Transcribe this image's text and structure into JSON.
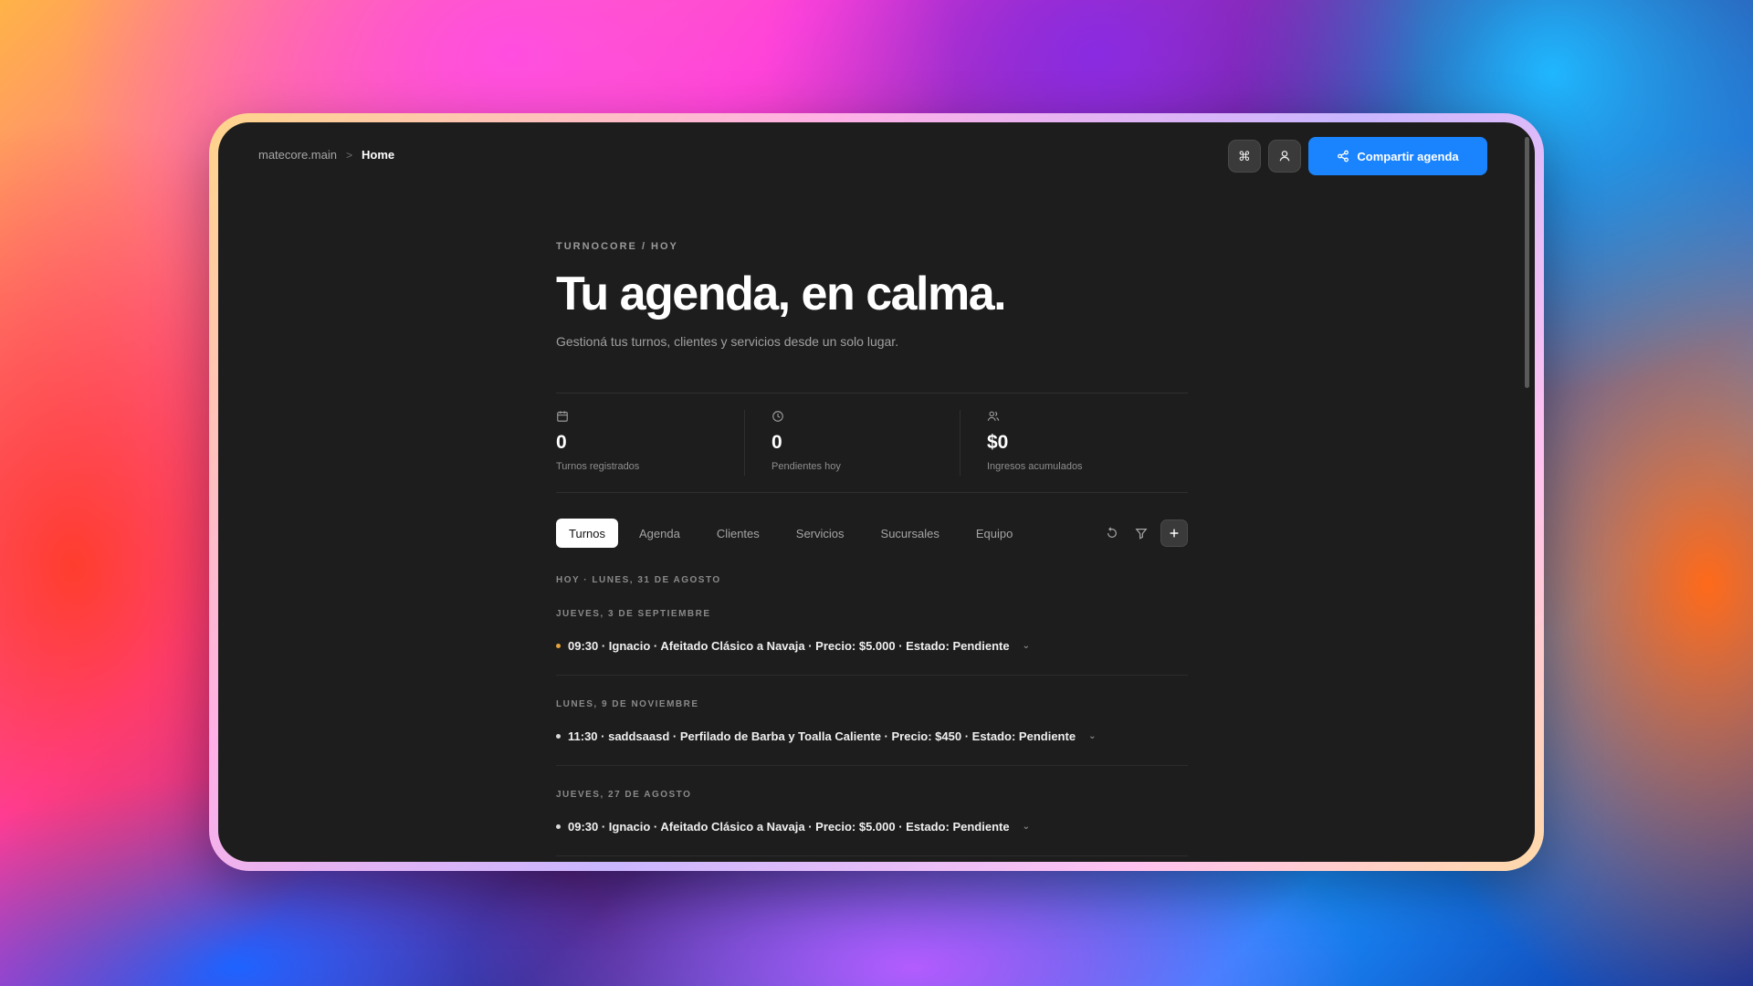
{
  "breadcrumb": {
    "root": "matecore.main",
    "separator": ">",
    "current": "Home"
  },
  "topbar": {
    "command_icon": "command-icon",
    "user_icon": "user-icon",
    "share_icon": "share-icon",
    "share_label": "Compartir agenda"
  },
  "hero": {
    "eyebrow": "TURNOCORE / HOY",
    "title": "Tu agenda, en calma.",
    "subtitle": "Gestioná tus turnos, clientes y servicios desde un solo lugar."
  },
  "stats": [
    {
      "icon": "calendar-icon",
      "value": "0",
      "label": "Turnos registrados"
    },
    {
      "icon": "clock-icon",
      "value": "0",
      "label": "Pendientes hoy"
    },
    {
      "icon": "users-icon",
      "value": "$0",
      "label": "Ingresos acumulados"
    }
  ],
  "tabs": [
    {
      "label": "Turnos",
      "active": true
    },
    {
      "label": "Agenda",
      "active": false
    },
    {
      "label": "Clientes",
      "active": false
    },
    {
      "label": "Servicios",
      "active": false
    },
    {
      "label": "Sucursales",
      "active": false
    },
    {
      "label": "Equipo",
      "active": false
    }
  ],
  "tab_actions": {
    "refresh_icon": "refresh-icon",
    "filter_icon": "filter-icon",
    "add_icon": "plus-icon"
  },
  "today_label": "HOY · LUNES, 31 DE AGOSTO",
  "groups": [
    {
      "date": "JUEVES, 3 DE SEPTIEMBRE",
      "item": "09:30 · Ignacio · Afeitado Clásico a Navaja · Precio: $5.000 · Estado: Pendiente",
      "dot_color": "#e6a23c"
    },
    {
      "date": "LUNES, 9 DE NOVIEMBRE",
      "item": "11:30 · saddsaasd · Perfilado de Barba y Toalla Caliente · Precio: $450 · Estado: Pendiente",
      "dot_color": "#d9d9d9"
    },
    {
      "date": "JUEVES, 27 DE AGOSTO",
      "item": "09:30 · Ignacio · Afeitado Clásico a Navaja · Precio: $5.000 · Estado: Pendiente",
      "dot_color": "#d9d9d9"
    }
  ],
  "colors": {
    "accent": "#1a84ff",
    "background": "#1d1d1d"
  }
}
